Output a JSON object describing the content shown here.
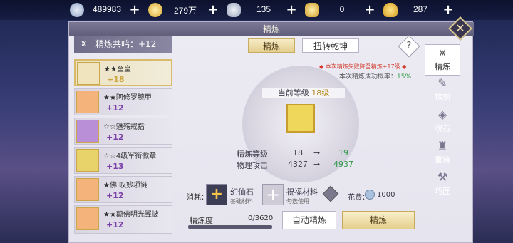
{
  "currencies": [
    {
      "icon": "silver-orb-icon",
      "value": "489983"
    },
    {
      "icon": "gold-coin-icon",
      "value": "279万"
    },
    {
      "icon": "silver-ingot-icon",
      "value": "135"
    },
    {
      "icon": "gold-ingot-icon",
      "value": "0"
    },
    {
      "icon": "yuanbao-icon",
      "value": "287"
    }
  ],
  "panel": {
    "title": "精炼",
    "close": "✕"
  },
  "resonance": {
    "label": "精炼共鸣：+12",
    "glyph": "⩙"
  },
  "items": [
    {
      "name": "★★奎皇",
      "level": "+18",
      "color": "#efe4bd",
      "selected": true
    },
    {
      "name": "★★阿修罗腕甲",
      "level": "+12",
      "color": "#f3b37a",
      "selected": false
    },
    {
      "name": "☆☆魅殇戒指",
      "level": "+12",
      "color": "#b98fd8",
      "selected": false
    },
    {
      "name": "☆☆4级军衔徽章",
      "level": "+13",
      "color": "#e8d36a",
      "selected": false
    },
    {
      "name": "★佛·叹妙项链",
      "level": "+12",
      "color": "#f3b37a",
      "selected": false
    },
    {
      "name": "★★颠佛明光翼披",
      "level": "+12",
      "color": "#f3b37a",
      "selected": false
    }
  ],
  "tabs": {
    "active": "精炼",
    "other": "扭转乾坤",
    "help": "?"
  },
  "hints": {
    "fail_note": "◆ 本次精炼失败降至精炼+17级 ◆",
    "rate_label": "本次精炼成功概率：",
    "rate_value": "15%"
  },
  "current": {
    "label": "当前等级",
    "value": "18级"
  },
  "stats": [
    {
      "key": "精炼等级",
      "from": "18",
      "arrow": "→",
      "to": "19"
    },
    {
      "key": "物理攻击",
      "from": "4327",
      "arrow": "→",
      "to": "4937"
    }
  ],
  "materials": {
    "consume_label": "消耗：",
    "mat1_name": "幻仙石",
    "mat1_sub": "基础材料",
    "mat2_name": "祝福材料",
    "mat2_sub": "勾选使用",
    "cost_label": "花费：",
    "cost_value": "1000"
  },
  "progress": {
    "label": "精炼度",
    "value": "0/3620",
    "fraction": 0.0
  },
  "buttons": {
    "auto": "自动精炼",
    "refine": "精炼"
  },
  "side_nav": [
    {
      "icon": "refine-icon",
      "label": "精炼",
      "active": true
    },
    {
      "icon": "engrave-icon",
      "label": "镌刻",
      "active": false
    },
    {
      "icon": "soul-stone-icon",
      "label": "魂石",
      "active": false
    },
    {
      "icon": "recast-icon",
      "label": "重铸",
      "active": false
    },
    {
      "icon": "craftsman-icon",
      "label": "巧匠",
      "active": false
    }
  ]
}
